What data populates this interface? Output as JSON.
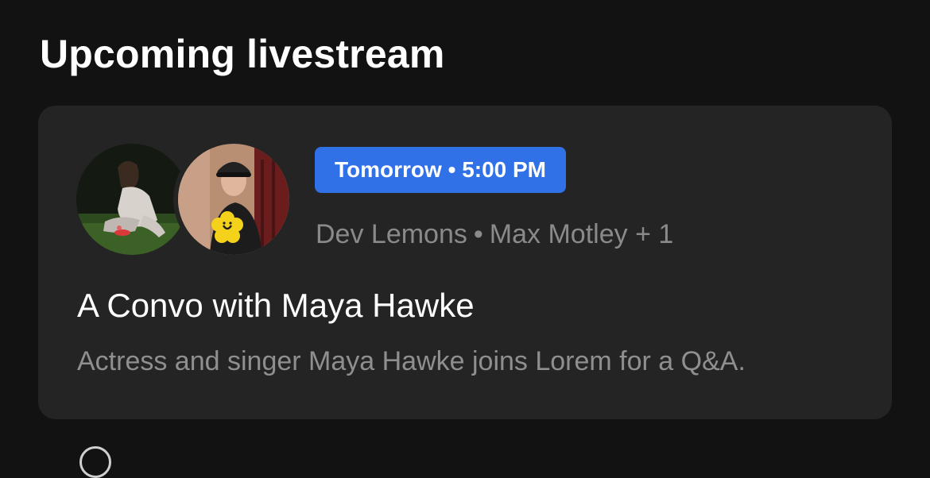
{
  "section": {
    "title": "Upcoming livestream"
  },
  "livestream": {
    "badge": {
      "day": "Tomorrow",
      "separator": "•",
      "time": "5:00 PM"
    },
    "hosts": {
      "first": "Dev Lemons",
      "separator": "•",
      "second": "Max Motley",
      "more": "+ 1"
    },
    "avatars": [
      "avatar-woman-on-grass",
      "avatar-man-in-cap-flower-shirt"
    ],
    "title": "A Convo with Maya Hawke",
    "description": "Actress and singer Maya Hawke joins Lorem for a Q&A."
  },
  "colors": {
    "background": "#121212",
    "card": "#242424",
    "badge": "#3071e8",
    "primary_text": "#ffffff",
    "secondary_text": "#8a8a8a"
  }
}
